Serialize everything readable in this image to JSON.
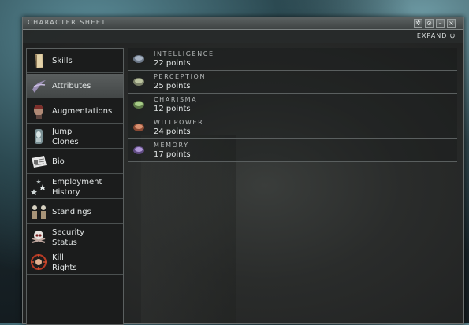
{
  "window": {
    "title": "CHARACTER SHEET",
    "expand_label": "EXPAND",
    "controls": [
      "settings",
      "help",
      "minimize",
      "close"
    ]
  },
  "sidebar": {
    "items": [
      {
        "label": "Skills",
        "icon": "book-icon",
        "active": false
      },
      {
        "label": "Attributes",
        "icon": "attributes-icon",
        "active": true
      },
      {
        "label": "Augmentations",
        "icon": "augmentation-head-icon",
        "active": false
      },
      {
        "label": "Jump\nClones",
        "icon": "jump-clone-icon",
        "active": false
      },
      {
        "label": "Bio",
        "icon": "bio-document-icon",
        "active": false
      },
      {
        "label": "Employment\nHistory",
        "icon": "employment-stars-icon",
        "active": false
      },
      {
        "label": "Standings",
        "icon": "standings-figures-icon",
        "active": false
      },
      {
        "label": "Security\nStatus",
        "icon": "security-skull-icon",
        "active": false
      },
      {
        "label": "Kill\nRights",
        "icon": "kill-rights-target-icon",
        "active": false
      }
    ]
  },
  "attributes": [
    {
      "name": "INTELLIGENCE",
      "value": "22 points",
      "color": "#9aa8b8"
    },
    {
      "name": "PERCEPTION",
      "value": "25 points",
      "color": "#a8b090"
    },
    {
      "name": "CHARISMA",
      "value": "12 points",
      "color": "#98b878"
    },
    {
      "name": "WILLPOWER",
      "value": "24 points",
      "color": "#c07050"
    },
    {
      "name": "MEMORY",
      "value": "17 points",
      "color": "#9878b8"
    }
  ]
}
